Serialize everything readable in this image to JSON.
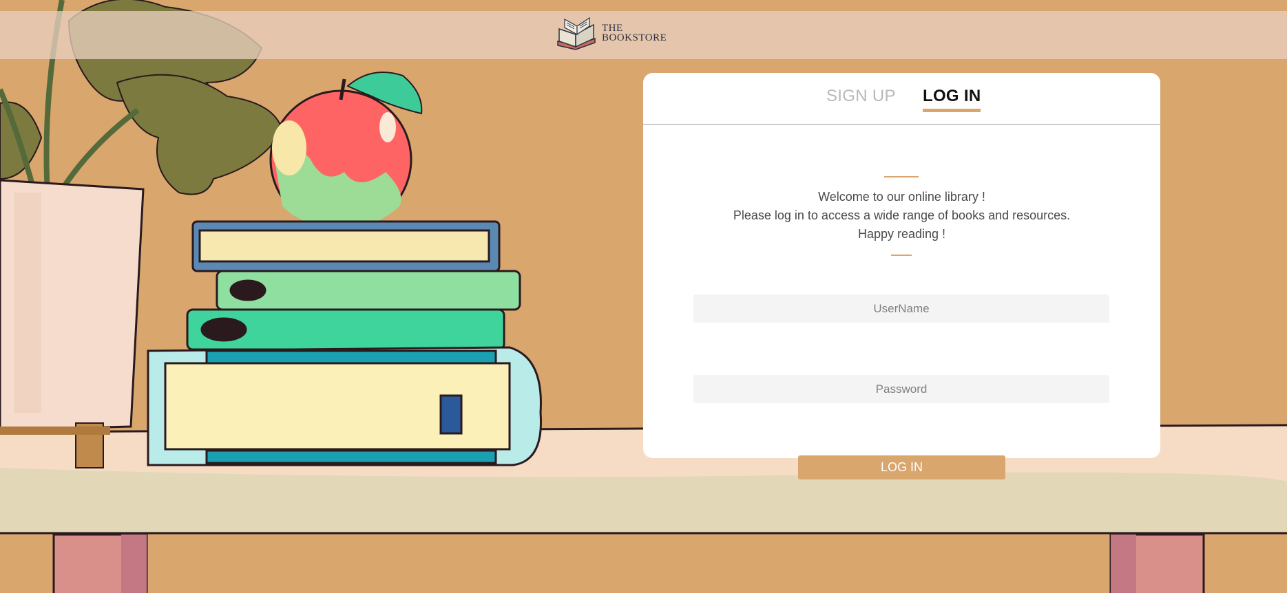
{
  "header": {
    "logo_line1": "THE",
    "logo_line2": "BOOKSTORE",
    "logo_icon": "open-book-icon"
  },
  "tabs": [
    {
      "label": "SIGN UP",
      "active": false
    },
    {
      "label": "LOG IN",
      "active": true
    }
  ],
  "welcome": {
    "line1": "Welcome to our online library !",
    "line2": "Please log in to access a wide range of books and resources.",
    "line3": "Happy reading !"
  },
  "form": {
    "username_placeholder": "UserName",
    "password_placeholder": "Password",
    "submit_label": "LOG IN"
  },
  "colors": {
    "background": "#d9a66e",
    "accent": "#d9a66e",
    "card": "#ffffff",
    "header_bar": "#e8d0be"
  }
}
